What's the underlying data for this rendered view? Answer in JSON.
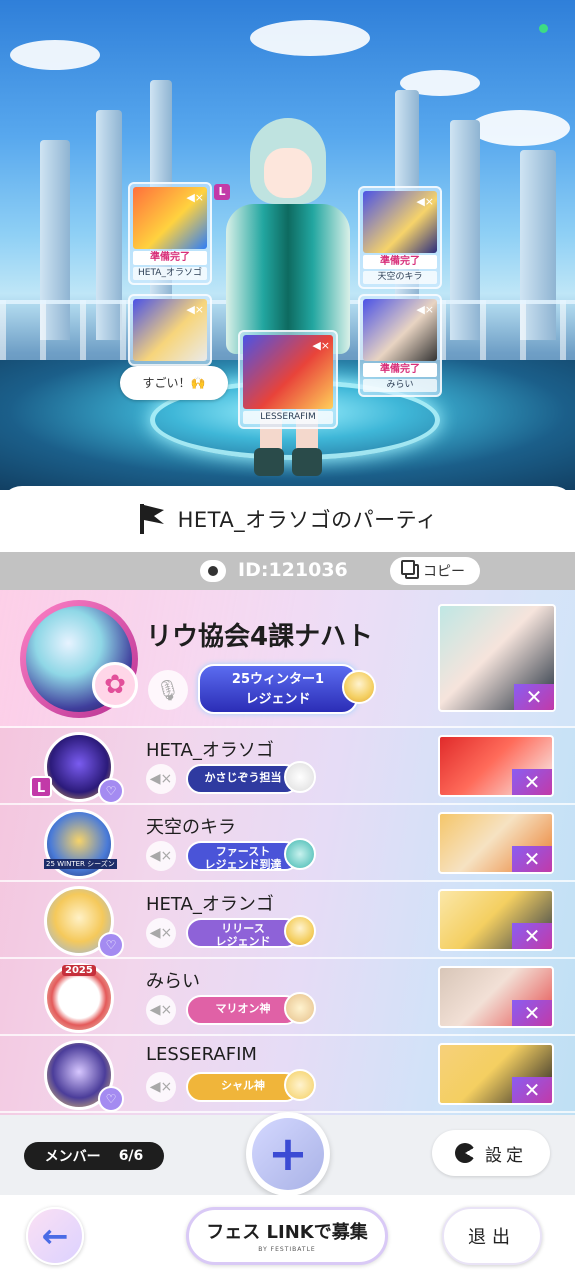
{
  "scene": {
    "status_color": "#3ddc84",
    "bubble_text": "すごい！🙌",
    "player_cards": [
      {
        "name": "HETA_オラソゴ",
        "status": "準備完了",
        "has_leader_badge": true,
        "leader_badge": "L"
      },
      {
        "name": "天空のキラ",
        "status": "準備完了"
      },
      {
        "name": "みらい",
        "status": "準備完了"
      },
      {
        "name": "LESSERAFIM",
        "status": ""
      }
    ]
  },
  "party": {
    "title": "HETA_オラソゴのパーティ",
    "id_label": "ID:121036",
    "copy_label": "コピー"
  },
  "host": {
    "name": "リウ協会4課ナハト",
    "title_plate": "25ウィンター1\nレジェンド",
    "title_plate_line1": "25ウィンター1",
    "title_plate_line2": "レジェンド"
  },
  "members": [
    {
      "name": "HETA_オラソゴ",
      "title_plate": "かさじぞう担当",
      "leader_badge": "L",
      "plate_color": "#2f3aa0"
    },
    {
      "name": "天空のキラ",
      "title_plate_line1": "ファースト",
      "title_plate_line2": "レジェンド到達",
      "plate_color": "#4a54d8"
    },
    {
      "name": "HETA_オランゴ",
      "title_plate_line1": "リリース",
      "title_plate_line2": "レジェンド",
      "plate_color": "#8e62d8"
    },
    {
      "name": "みらい",
      "title_plate": "マリオン神",
      "plate_color": "#e061a6"
    },
    {
      "name": "LESSERAFIM",
      "title_plate": "シャル神",
      "plate_color": "#f0b53a"
    }
  ],
  "member_icons": {
    "winter_text": "25 WINTER シーズン",
    "year_text": "2025"
  },
  "footer": {
    "member_label": "メンバー",
    "member_count": "6/6",
    "add_icon": "plus-icon",
    "settings_label": "設定",
    "back_icon": "arrow-left-icon",
    "link_label": "フェス LINKで募集",
    "link_sub": "BY FESTIBATLE",
    "exit_label": "退出"
  },
  "icons": {
    "mute": "mic-off-icon",
    "speaker_muted": "speaker-muted-icon",
    "eye": "eye-icon",
    "copy": "copy-icon",
    "x_badge": "x-rank-icon"
  }
}
